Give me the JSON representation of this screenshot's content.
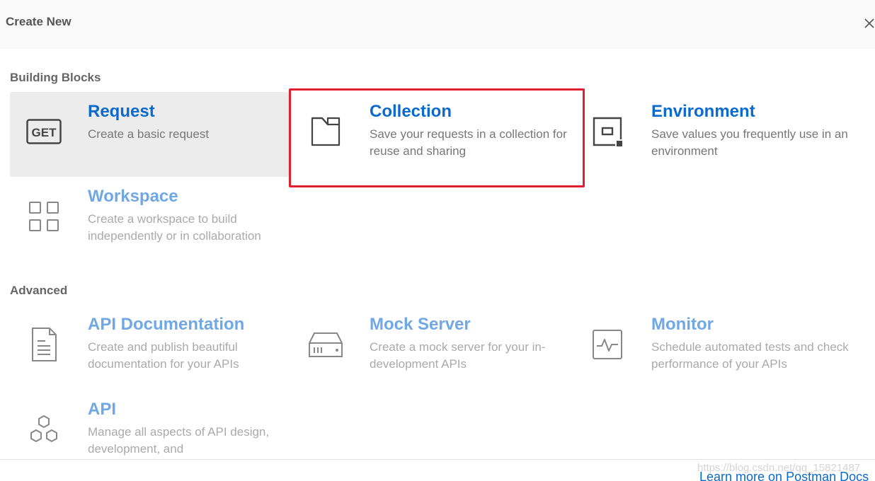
{
  "header": {
    "title": "Create New",
    "close_icon": "close-icon"
  },
  "sections": {
    "building_blocks": "Building Blocks",
    "advanced": "Advanced"
  },
  "building_blocks": [
    {
      "title": "Request",
      "description": "Create a basic request",
      "icon": "get-icon",
      "icon_text": "GET"
    },
    {
      "title": "Collection",
      "description": "Save your requests in a collection for reuse and sharing",
      "icon": "folder-icon"
    },
    {
      "title": "Environment",
      "description": "Save values you frequently use in an environment",
      "icon": "environment-icon"
    },
    {
      "title": "Workspace",
      "description": "Create a workspace to build independently or in collaboration",
      "icon": "grid-icon"
    }
  ],
  "advanced": [
    {
      "title": "API Documentation",
      "description": "Create and publish beautiful documentation for your APIs",
      "icon": "document-icon"
    },
    {
      "title": "Mock Server",
      "description": "Create a mock server for your in-development APIs",
      "icon": "server-icon"
    },
    {
      "title": "Monitor",
      "description": "Schedule automated tests and check performance of your APIs",
      "icon": "monitor-icon"
    },
    {
      "title": "API",
      "description": "Manage all aspects of API design, development, and",
      "icon": "hexagons-icon"
    }
  ],
  "footer": {
    "link": "Learn more on Postman Docs",
    "watermark": "https://blog.csdn.net/qq_15821487"
  },
  "colors": {
    "accent": "#0b6acd",
    "accent_muted": "#6fa8e4",
    "highlight": "#e0202c",
    "hover_bg": "#ececec"
  }
}
